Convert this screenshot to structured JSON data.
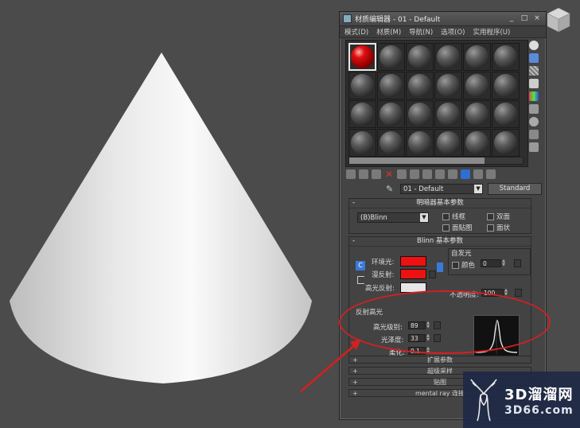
{
  "window": {
    "title": "材质编辑器 - 01 - Default",
    "controls": [
      "_",
      "□",
      "×"
    ]
  },
  "menu": [
    "模式(D)",
    "材质(M)",
    "导航(N)",
    "选项(O)",
    "实用程序(U)"
  ],
  "sample_slots": {
    "rows": 4,
    "cols": 6,
    "active_index": 0,
    "active_color": "#d01010"
  },
  "material": {
    "name": "01 - Default",
    "type_button": "Standard"
  },
  "shader_basic": {
    "title": "明暗器基本参数",
    "shader": "(B)Blinn",
    "options": [
      "线框",
      "双面",
      "面贴图",
      "面状"
    ]
  },
  "blinn_basic": {
    "title": "Blinn 基本参数",
    "lock_label": "C",
    "ambient_label": "环境光:",
    "diffuse_label": "漫反射:",
    "specular_label": "高光反射:",
    "ambient_color": "#ee1111",
    "diffuse_color": "#ee1111",
    "specular_color": "#e6e6e6",
    "self_illum_title": "自发光",
    "color_label": "颜色",
    "self_illum_value": "0",
    "opacity_label": "不透明度:",
    "opacity_value": "100"
  },
  "specular_highlights": {
    "title": "反射高光",
    "level_label": "高光级别:",
    "level_value": "89",
    "gloss_label": "光泽度:",
    "gloss_value": "33",
    "soften_label": "柔化:",
    "soften_value": "0.1"
  },
  "collapsed_rollouts": [
    "扩展参数",
    "超级采样",
    "贴图",
    "mental ray 连接"
  ],
  "watermark": {
    "brand": "3D溜溜网",
    "url": "3D66.com"
  },
  "colors": {
    "annotation": "#d42020",
    "viewport_bg": "#4b4b4b"
  }
}
